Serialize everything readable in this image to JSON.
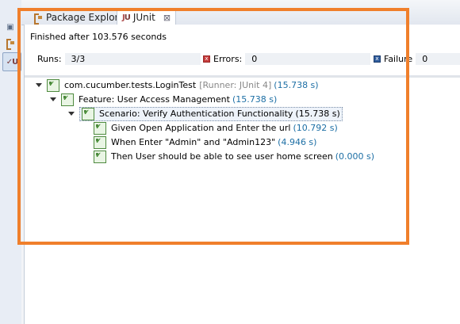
{
  "tabs": {
    "package_explorer": "Package Explorer",
    "junit": "JUnit",
    "close_glyph": "⊠"
  },
  "status": {
    "finished": "Finished after 103.576 seconds"
  },
  "counters": {
    "runs_label": "Runs:",
    "runs_value": "3/3",
    "errors_label": "Errors:",
    "errors_value": "0",
    "failures_label": "Failure",
    "failures_value": "0"
  },
  "tree": {
    "root": {
      "name": "com.cucumber.tests.LoginTest",
      "runner": "[Runner: JUnit 4]",
      "time": "(15.738 s)"
    },
    "feature": {
      "name": "Feature: User Access Management",
      "time": "(15.738 s)"
    },
    "scenario": {
      "name": "Scenario: Verify Authentication Functionality",
      "time": "(15.738 s)"
    },
    "steps": [
      {
        "name": "Given Open Application and Enter the url",
        "time": "(10.792 s)"
      },
      {
        "name": "When Enter \"Admin\" and \"Admin123\"",
        "time": "(4.946 s)"
      },
      {
        "name": "Then User should be able to see user home screen",
        "time": "(0.000 s)"
      }
    ]
  },
  "colors": {
    "highlight": "#f07f2b",
    "duration_text": "#1d6fa5",
    "pass_green": "#4e8a3f"
  },
  "icons": {
    "left_strip": [
      "restore-icon",
      "package-explorer-icon",
      "junit-icon"
    ],
    "tree_test": "test-passed-icon",
    "error": "error-icon",
    "failure": "failure-icon"
  }
}
